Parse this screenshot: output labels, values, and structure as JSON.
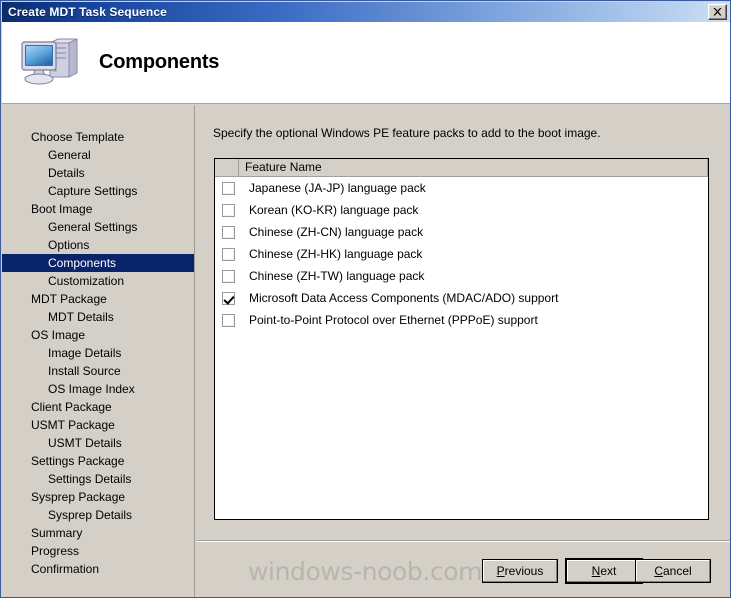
{
  "window": {
    "title": "Create MDT Task Sequence",
    "close_label": "✕",
    "close_icon": "close-icon"
  },
  "header": {
    "title": "Components",
    "icon": "computer-icon"
  },
  "sidebar": {
    "items": [
      {
        "label": "Choose Template",
        "level": 0,
        "selected": false
      },
      {
        "label": "General",
        "level": 1,
        "selected": false
      },
      {
        "label": "Details",
        "level": 1,
        "selected": false
      },
      {
        "label": "Capture Settings",
        "level": 1,
        "selected": false
      },
      {
        "label": "Boot Image",
        "level": 0,
        "selected": false
      },
      {
        "label": "General Settings",
        "level": 1,
        "selected": false
      },
      {
        "label": "Options",
        "level": 1,
        "selected": false
      },
      {
        "label": "Components",
        "level": 1,
        "selected": true
      },
      {
        "label": "Customization",
        "level": 1,
        "selected": false
      },
      {
        "label": "MDT Package",
        "level": 0,
        "selected": false
      },
      {
        "label": "MDT Details",
        "level": 1,
        "selected": false
      },
      {
        "label": "OS Image",
        "level": 0,
        "selected": false
      },
      {
        "label": "Image Details",
        "level": 1,
        "selected": false
      },
      {
        "label": "Install Source",
        "level": 1,
        "selected": false
      },
      {
        "label": "OS Image Index",
        "level": 1,
        "selected": false
      },
      {
        "label": "Client Package",
        "level": 0,
        "selected": false
      },
      {
        "label": "USMT Package",
        "level": 0,
        "selected": false
      },
      {
        "label": "USMT Details",
        "level": 1,
        "selected": false
      },
      {
        "label": "Settings Package",
        "level": 0,
        "selected": false
      },
      {
        "label": "Settings Details",
        "level": 1,
        "selected": false
      },
      {
        "label": "Sysprep Package",
        "level": 0,
        "selected": false
      },
      {
        "label": "Sysprep Details",
        "level": 1,
        "selected": false
      },
      {
        "label": "Summary",
        "level": 0,
        "selected": false
      },
      {
        "label": "Progress",
        "level": 0,
        "selected": false
      },
      {
        "label": "Confirmation",
        "level": 0,
        "selected": false
      }
    ]
  },
  "main": {
    "instruction": "Specify the optional Windows PE feature packs to add to the boot image.",
    "list": {
      "columns": [
        "",
        "Feature Name"
      ],
      "rows": [
        {
          "checked": false,
          "label": "Japanese (JA-JP) language pack"
        },
        {
          "checked": false,
          "label": "Korean (KO-KR) language pack"
        },
        {
          "checked": false,
          "label": "Chinese (ZH-CN) language pack"
        },
        {
          "checked": false,
          "label": "Chinese (ZH-HK) language pack"
        },
        {
          "checked": false,
          "label": "Chinese (ZH-TW) language pack"
        },
        {
          "checked": true,
          "label": "Microsoft Data Access Components (MDAC/ADO) support"
        },
        {
          "checked": false,
          "label": "Point-to-Point Protocol over Ethernet (PPPoE) support"
        }
      ]
    }
  },
  "watermark": {
    "text": "windows-noob.com"
  },
  "footer": {
    "previous": {
      "label": "Previous",
      "accel": "P"
    },
    "next": {
      "label": "Next",
      "accel": "N"
    },
    "cancel": {
      "label": "Cancel",
      "accel": "C"
    }
  },
  "colors": {
    "titlebar_start": "#0a2c6e",
    "titlebar_end": "#cfe0f5",
    "dialog_face": "#d4d0c8",
    "selection": "#0a246a",
    "watermark": "#b9b5ad"
  }
}
